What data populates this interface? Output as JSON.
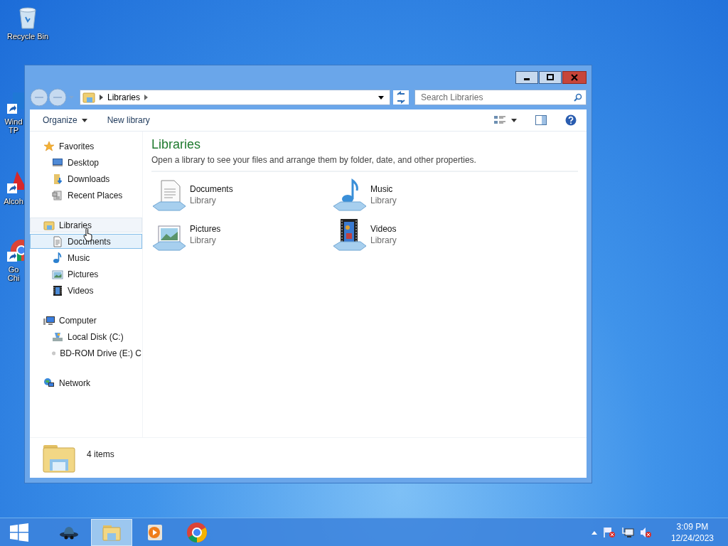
{
  "desktop_icons": [
    {
      "kind": "recycle",
      "lines": [
        "Recycle Bin"
      ]
    },
    {
      "kind": "shortcut-blue",
      "lines": [
        "Wind",
        "TP"
      ]
    },
    {
      "kind": "shortcut-red",
      "lines": [
        "Alcoh"
      ]
    },
    {
      "kind": "shortcut-chrome",
      "lines": [
        "Go",
        "Chi"
      ]
    }
  ],
  "window": {
    "address": {
      "crumbs": [
        "Libraries"
      ]
    },
    "search": {
      "placeholder": "Search Libraries"
    },
    "toolbar": {
      "buttons": [
        {
          "label": "Organize",
          "dropdown": true
        },
        {
          "label": "New library",
          "dropdown": false
        }
      ]
    },
    "nav_groups": [
      {
        "label": "Favorites",
        "kind": "star",
        "selected": false,
        "hovered": false,
        "children": [
          {
            "label": "Desktop",
            "kind": "desktop",
            "selected": false,
            "hovered": false
          },
          {
            "label": "Downloads",
            "kind": "downloads",
            "selected": false,
            "hovered": false
          },
          {
            "label": "Recent Places",
            "kind": "recent",
            "selected": false,
            "hovered": false
          }
        ]
      },
      {
        "label": "Libraries",
        "kind": "libraries",
        "selected": false,
        "hovered": true,
        "children": [
          {
            "label": "Documents",
            "kind": "documents",
            "selected": true,
            "hovered": false
          },
          {
            "label": "Music",
            "kind": "music",
            "selected": false,
            "hovered": false
          },
          {
            "label": "Pictures",
            "kind": "pictures",
            "selected": false,
            "hovered": false
          },
          {
            "label": "Videos",
            "kind": "videos",
            "selected": false,
            "hovered": false
          }
        ]
      },
      {
        "label": "Computer",
        "kind": "computer",
        "selected": false,
        "hovered": false,
        "children": [
          {
            "label": "Local Disk (C:)",
            "kind": "disk",
            "selected": false,
            "hovered": false
          },
          {
            "label": "BD-ROM Drive (E:) C",
            "kind": "bdrom",
            "selected": false,
            "hovered": false
          }
        ]
      },
      {
        "label": "Network",
        "kind": "network",
        "selected": false,
        "hovered": false
      }
    ],
    "content": {
      "title": "Libraries",
      "description": "Open a library to see your files and arrange them by folder, date, and other properties.",
      "libraries": [
        {
          "name": "Documents",
          "type": "Library",
          "kind": "documents"
        },
        {
          "name": "Music",
          "type": "Library",
          "kind": "music"
        },
        {
          "name": "Pictures",
          "type": "Library",
          "kind": "pictures"
        },
        {
          "name": "Videos",
          "type": "Library",
          "kind": "videos"
        }
      ]
    },
    "status_bar": {
      "count": "4 items"
    }
  },
  "taskbar": {
    "apps": [
      {
        "kind": "hat",
        "selected": false
      },
      {
        "kind": "explorer",
        "selected": true
      },
      {
        "kind": "media",
        "selected": false
      },
      {
        "kind": "chrome",
        "selected": false
      }
    ],
    "clock": {
      "time": "3:09 PM",
      "date": "12/24/2023"
    }
  }
}
